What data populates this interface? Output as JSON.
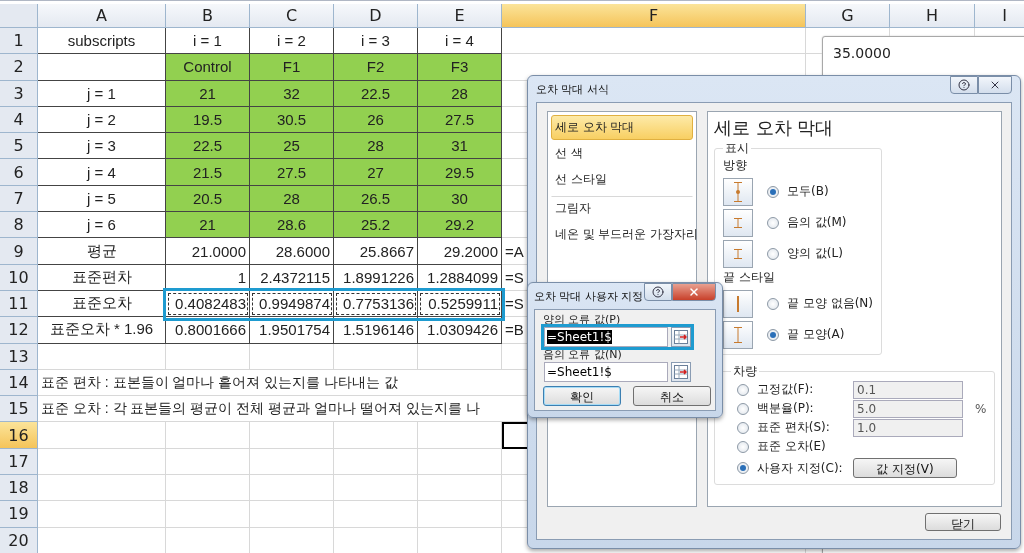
{
  "spreadsheet": {
    "columns": [
      {
        "label": "A",
        "selected": false
      },
      {
        "label": "B",
        "selected": false
      },
      {
        "label": "C",
        "selected": false
      },
      {
        "label": "D",
        "selected": false
      },
      {
        "label": "E",
        "selected": false
      },
      {
        "label": "F",
        "selected": true
      },
      {
        "label": "G",
        "selected": false
      },
      {
        "label": "H",
        "selected": false
      },
      {
        "label": "I",
        "selected": false
      }
    ],
    "rows": [
      {
        "header": "1",
        "selected": false,
        "kind": "label",
        "cells": [
          {
            "text": "subscripts",
            "shaded": false
          },
          {
            "text": "i = 1",
            "shaded": false
          },
          {
            "text": "i = 2",
            "shaded": false
          },
          {
            "text": "i = 3",
            "shaded": false
          },
          {
            "text": "i = 4",
            "shaded": false
          }
        ]
      },
      {
        "header": "2",
        "selected": false,
        "kind": "label",
        "cells": [
          {
            "shaded": false
          },
          {
            "text": "Control",
            "shaded": true
          },
          {
            "text": "F1",
            "shaded": true
          },
          {
            "text": "F2",
            "shaded": true
          },
          {
            "text": "F3",
            "shaded": true
          }
        ]
      },
      {
        "header": "3",
        "selected": false,
        "kind": "label",
        "cells": [
          {
            "text": "j = 1",
            "shaded": false
          },
          {
            "text": "21",
            "shaded": true
          },
          {
            "text": "32",
            "shaded": true
          },
          {
            "text": "22.5",
            "shaded": true
          },
          {
            "text": "28",
            "shaded": true
          }
        ]
      },
      {
        "header": "4",
        "selected": false,
        "kind": "label",
        "cells": [
          {
            "text": "j = 2",
            "shaded": false
          },
          {
            "text": "19.5",
            "shaded": true
          },
          {
            "text": "30.5",
            "shaded": true
          },
          {
            "text": "26",
            "shaded": true
          },
          {
            "text": "27.5",
            "shaded": true
          }
        ]
      },
      {
        "header": "5",
        "selected": false,
        "kind": "label",
        "cells": [
          {
            "text": "j = 3",
            "shaded": false
          },
          {
            "text": "22.5",
            "shaded": true
          },
          {
            "text": "25",
            "shaded": true
          },
          {
            "text": "28",
            "shaded": true
          },
          {
            "text": "31",
            "shaded": true
          }
        ]
      },
      {
        "header": "6",
        "selected": false,
        "kind": "label",
        "cells": [
          {
            "text": "j = 4",
            "shaded": false
          },
          {
            "text": "21.5",
            "shaded": true
          },
          {
            "text": "27.5",
            "shaded": true
          },
          {
            "text": "27",
            "shaded": true
          },
          {
            "text": "29.5",
            "shaded": true
          }
        ]
      },
      {
        "header": "7",
        "selected": false,
        "kind": "label",
        "cells": [
          {
            "text": "j = 5",
            "shaded": false
          },
          {
            "text": "20.5",
            "shaded": true
          },
          {
            "text": "28",
            "shaded": true
          },
          {
            "text": "26.5",
            "shaded": true
          },
          {
            "text": "30",
            "shaded": true
          }
        ]
      },
      {
        "header": "8",
        "selected": false,
        "kind": "label",
        "cells": [
          {
            "text": "j = 6",
            "shaded": false
          },
          {
            "text": "21",
            "shaded": true
          },
          {
            "text": "28.6",
            "shaded": true
          },
          {
            "text": "25.2",
            "shaded": true
          },
          {
            "text": "29.2",
            "shaded": true
          }
        ]
      },
      {
        "header": "9",
        "selected": false,
        "kind": "stat",
        "cells": [
          {
            "text": "평균",
            "shaded": false
          },
          {
            "text": "21.0000",
            "shaded": false
          },
          {
            "text": "28.6000",
            "shaded": false
          },
          {
            "text": "25.8667",
            "shaded": false
          },
          {
            "text": "29.2000",
            "shaded": false
          },
          {
            "text": "=A",
            "shaded": false
          }
        ]
      },
      {
        "header": "10",
        "selected": false,
        "kind": "stat",
        "cells": [
          {
            "text": "표준편차",
            "shaded": false
          },
          {
            "text": "1",
            "shaded": false
          },
          {
            "text": "2.4372115",
            "shaded": false
          },
          {
            "text": "1.8991226",
            "shaded": false
          },
          {
            "text": "1.2884099",
            "shaded": false
          },
          {
            "text": "=S",
            "shaded": false
          }
        ]
      },
      {
        "header": "11",
        "selected": false,
        "kind": "stat",
        "copied": true,
        "annotated": true,
        "cells": [
          {
            "text": "표준오차",
            "shaded": false
          },
          {
            "text": "0.4082483",
            "shaded": false
          },
          {
            "text": "0.9949874",
            "shaded": false
          },
          {
            "text": "0.7753136",
            "shaded": false
          },
          {
            "text": "0.5259911",
            "shaded": false
          },
          {
            "text": "=S",
            "shaded": false
          }
        ]
      },
      {
        "header": "12",
        "selected": false,
        "kind": "stat",
        "cells": [
          {
            "text": "표준오차 * 1.96",
            "shaded": false
          },
          {
            "text": "0.8001666",
            "shaded": false
          },
          {
            "text": "1.9501754",
            "shaded": false
          },
          {
            "text": "1.5196146",
            "shaded": false
          },
          {
            "text": "1.0309426",
            "shaded": false
          },
          {
            "text": "=B",
            "shaded": false
          }
        ]
      },
      {
        "header": "13",
        "selected": false,
        "kind": "empty"
      },
      {
        "header": "14",
        "selected": false,
        "kind": "note",
        "note": "표준 편차 : 표본들이 얼마나 흩어져 있는지를 나타내는 값"
      },
      {
        "header": "15",
        "selected": false,
        "kind": "note",
        "note": "표준 오차 : 각 표본들의 평균이 전체 평균과 얼마나 떨어져 있는지를 나"
      },
      {
        "header": "16",
        "selected": true,
        "kind": "empty"
      },
      {
        "header": "17",
        "selected": false,
        "kind": "empty"
      },
      {
        "header": "18",
        "selected": false,
        "kind": "empty"
      },
      {
        "header": "19",
        "selected": false,
        "kind": "empty"
      },
      {
        "header": "20",
        "selected": false,
        "kind": "empty"
      }
    ]
  },
  "chart_fragment": {
    "axis_labels": [
      "35.0000"
    ]
  },
  "format_dialog": {
    "title": "오차 막대 서식",
    "categories": [
      {
        "label": "세로 오차 막대",
        "selected": true,
        "divider_before": false
      },
      {
        "label": "선 색",
        "selected": false,
        "divider_before": false
      },
      {
        "label": "선 스타일",
        "selected": false,
        "divider_before": false
      },
      {
        "label": "그림자",
        "selected": false,
        "divider_before": true
      },
      {
        "label": "네온 및 부드러운 가장자리",
        "selected": false,
        "divider_before": false
      }
    ],
    "heading": "세로 오차 막대",
    "display_group": {
      "title": "표시",
      "direction_label": "방향",
      "directions": [
        {
          "kind": "both",
          "label": "모두(B)",
          "selected": true
        },
        {
          "kind": "minus",
          "label": "음의 값(M)",
          "selected": false
        },
        {
          "kind": "plus",
          "label": "양의 값(L)",
          "selected": false
        }
      ],
      "end_style_label": "끝 스타일",
      "end_styles": [
        {
          "kind": "none",
          "label": "끝 모양 없음(N)",
          "selected": false
        },
        {
          "kind": "cap",
          "label": "끝 모양(A)",
          "selected": true
        }
      ]
    },
    "amount_group": {
      "title": "차량",
      "options": [
        {
          "label": "고정값(F):",
          "selected": false,
          "value": "0.1"
        },
        {
          "label": "백분율(P):",
          "selected": false,
          "value": "5.0",
          "unit": "%"
        },
        {
          "label": "표준 편차(S):",
          "selected": false,
          "value": "1.0"
        },
        {
          "label": "표준 오차(E)",
          "selected": false
        },
        {
          "label": "사용자 지정(C):",
          "selected": true,
          "button": "값 지정(V)"
        }
      ]
    },
    "close_button": "닫기"
  },
  "custom_dialog": {
    "title": "오차 막대 사용자 지정",
    "fields": [
      {
        "label": "양의 오류 값(P)",
        "value": "=Sheet1!$",
        "selected": true,
        "annotated": true
      },
      {
        "label": "음의 오류 값(N)",
        "value": "=Sheet1!$",
        "selected": false,
        "annotated": false
      }
    ],
    "buttons": [
      {
        "label": "확인",
        "default": true
      },
      {
        "label": "취소",
        "default": false
      }
    ]
  }
}
